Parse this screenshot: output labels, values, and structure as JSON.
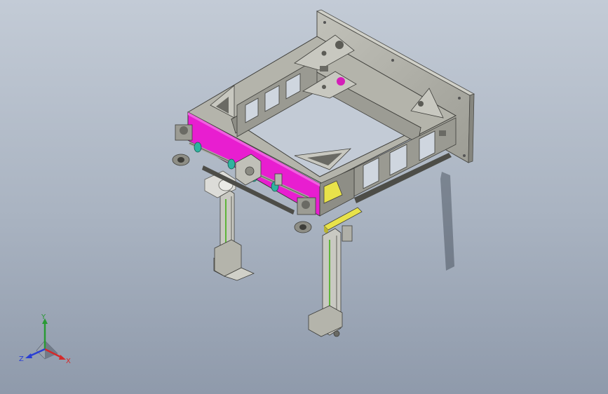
{
  "viewport": {
    "background_top": "#c3cbd6",
    "background_bottom": "#8f9aab"
  },
  "model": {
    "frame_color": "#a9a9a1",
    "panel_color": "#e81ed0",
    "rail_color": "#5fb53a",
    "bracket_color": "#e8e24a",
    "shaft_color": "#2fb39f"
  },
  "triad": {
    "y_label": "Y",
    "x_label": "X",
    "z_label": "Z",
    "y_color": "#2a9a35",
    "x_color": "#d42a2a",
    "z_color": "#2a3fd4"
  }
}
